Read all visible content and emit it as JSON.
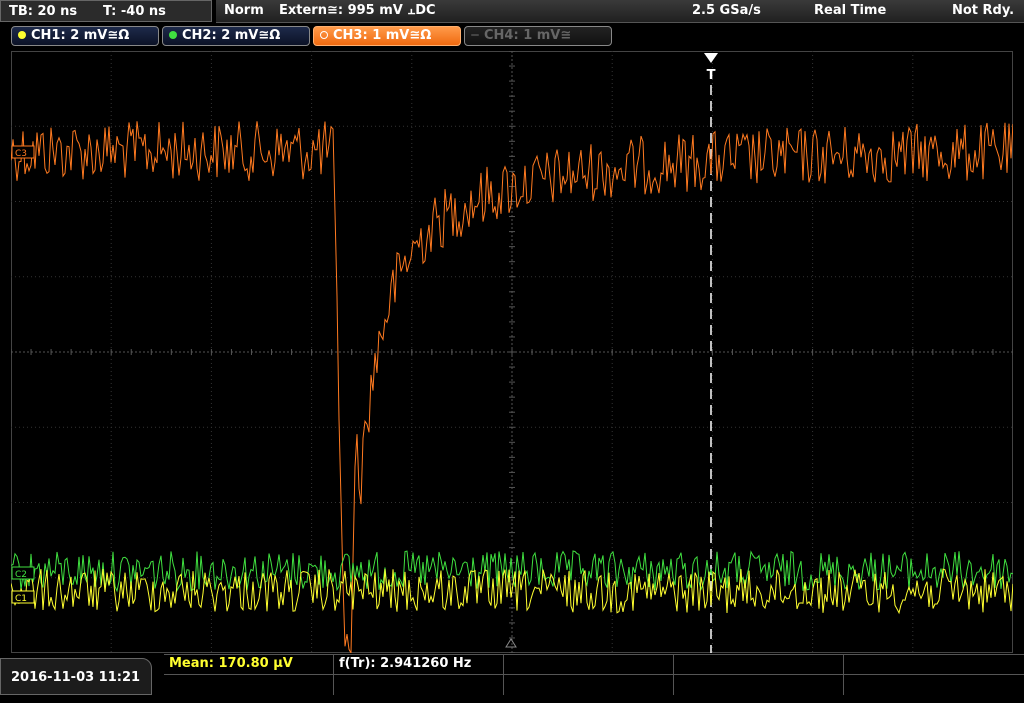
{
  "timebase": {
    "tb": "TB: 20 ns",
    "trigger_offset": "T: -40 ns"
  },
  "status": {
    "mode": "Norm",
    "trigger": "Extern≅: 995 mV ⫠DC",
    "sample_rate": "2.5 GSa/s",
    "acquisition": "Real Time",
    "state": "Not Rdy."
  },
  "channels": [
    {
      "label": "CH1: 2 mV≅Ω",
      "color": "#ffff30",
      "active": false,
      "enabled": true
    },
    {
      "label": "CH2: 2 mV≅Ω",
      "color": "#40e040",
      "active": false,
      "enabled": true
    },
    {
      "label": "CH3: 1 mV≅Ω",
      "color": "#ff7a20",
      "active": true,
      "enabled": true
    },
    {
      "label": "CH4: 1 mV≅",
      "color": "#666666",
      "active": false,
      "enabled": false
    }
  ],
  "markers": {
    "trigger": "T",
    "ch3": "C3",
    "ch2": "C2",
    "ch1": "C1"
  },
  "measurements": {
    "mean": "Mean: 170.80 µV",
    "freq": "f(Tr): 2.941260 Hz"
  },
  "datetime": "2016-11-03 11:21",
  "colors": {
    "ch1": "#ffff30",
    "ch2": "#40e040",
    "ch3": "#ff7a20",
    "grid": "#3a3a3a",
    "trigger_line": "#ffffff"
  }
}
